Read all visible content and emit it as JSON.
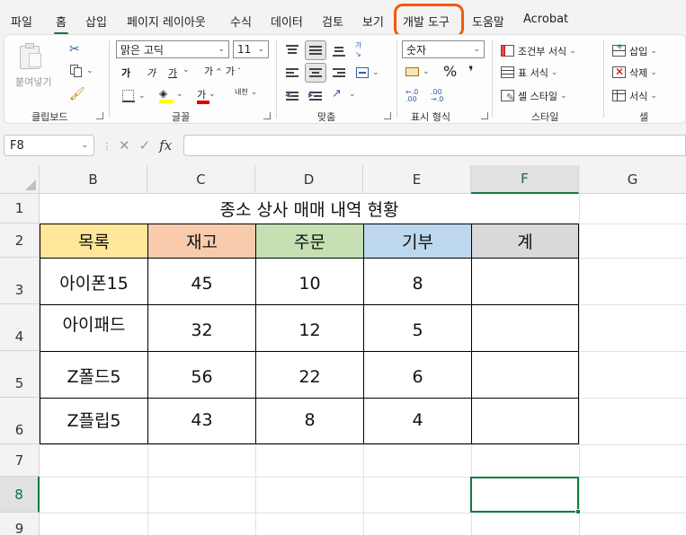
{
  "menu": {
    "tabs": [
      "파일",
      "홈",
      "삽입",
      "페이지 레이아웃",
      "수식",
      "데이터",
      "검토",
      "보기",
      "개발 도구",
      "도움말",
      "Acrobat"
    ],
    "active_index": 1,
    "highlighted_index": 8
  },
  "ribbon": {
    "clipboard": {
      "paste": "붙여넣기",
      "label": "클립보드"
    },
    "font": {
      "name": "맑은 고딕",
      "size": "11",
      "bold": "가",
      "italic": "가",
      "underline": "가",
      "grow": "가",
      "shrink": "가",
      "fontcolor": "가",
      "phonetic": "내천",
      "label": "글꼴"
    },
    "alignment": {
      "label": "맞춤"
    },
    "number": {
      "format": "숫자",
      "percent": "%",
      "comma": "❜",
      "label": "표시 형식"
    },
    "styles": {
      "conditional": "조건부 서식",
      "table": "표 서식",
      "cell": "셀 스타일",
      "label": "스타일"
    },
    "cells": {
      "insert": "삽입",
      "delete": "삭제",
      "format": "서식",
      "label": "셀"
    }
  },
  "formula_bar": {
    "name_box": "F8",
    "fx": "fx",
    "value": ""
  },
  "grid": {
    "columns": [
      "B",
      "C",
      "D",
      "E",
      "F",
      "G"
    ],
    "selected_column": "F",
    "rows": [
      "1",
      "2",
      "3",
      "4",
      "5",
      "6",
      "7",
      "8",
      "9"
    ],
    "selected_row": "8",
    "title": "종소 상사 매매 내역 현황",
    "headers": [
      "목록",
      "재고",
      "주문",
      "기부",
      "계"
    ],
    "header_colors": [
      "#ffe699",
      "#f8cbad",
      "#c6e0b4",
      "#bdd7ee",
      "#d9d9d9"
    ],
    "data": [
      [
        "아이폰15",
        "45",
        "10",
        "8",
        ""
      ],
      [
        "아이패드",
        "32",
        "12",
        "5",
        ""
      ],
      [
        "Z폴드5",
        "56",
        "22",
        "6",
        ""
      ],
      [
        "Z플립5",
        "43",
        "8",
        "4",
        ""
      ]
    ],
    "selected_cell": "F8"
  },
  "colors": {
    "accent": "#107c41",
    "highlight_ring": "#f05a0e"
  }
}
